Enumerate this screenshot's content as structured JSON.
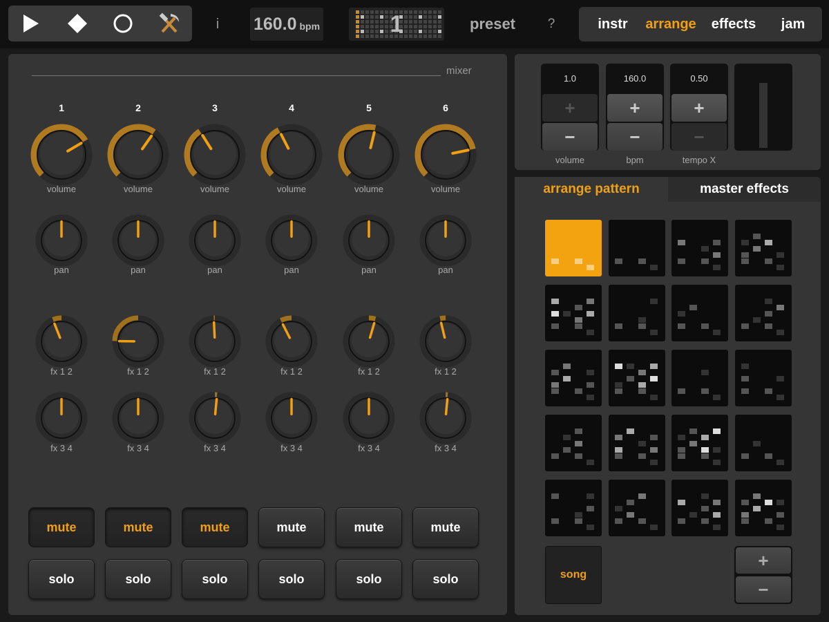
{
  "topbar": {
    "info_label": "i",
    "bpm_value": "160.0",
    "bpm_unit": "bpm",
    "current_pattern": "1",
    "preset_label": "preset",
    "help_label": "?",
    "tabs": [
      {
        "label": "instr",
        "active": false
      },
      {
        "label": "arrange",
        "active": true
      },
      {
        "label": "effects",
        "active": false
      },
      {
        "label": "jam",
        "active": false
      }
    ]
  },
  "mixer": {
    "title": "mixer",
    "knob_labels": {
      "volume": "volume",
      "pan": "pan",
      "fx12": "fx 1 2",
      "fx34": "fx 3 4"
    },
    "channels": [
      {
        "num": "1",
        "volume": 0.72,
        "pan": 0.5,
        "fx12": 0.42,
        "fx34": 0.5,
        "mute_label": "mute",
        "mute_on": true,
        "solo_label": "solo"
      },
      {
        "num": "2",
        "volume": 0.63,
        "pan": 0.5,
        "fx12": 0.17,
        "fx34": 0.5,
        "mute_label": "mute",
        "mute_on": true,
        "solo_label": "solo"
      },
      {
        "num": "3",
        "volume": 0.38,
        "pan": 0.5,
        "fx12": 0.49,
        "fx34": 0.52,
        "mute_label": "mute",
        "mute_on": true,
        "solo_label": "solo"
      },
      {
        "num": "4",
        "volume": 0.4,
        "pan": 0.5,
        "fx12": 0.4,
        "fx34": 0.5,
        "mute_label": "mute",
        "mute_on": false,
        "solo_label": "solo"
      },
      {
        "num": "5",
        "volume": 0.55,
        "pan": 0.5,
        "fx12": 0.56,
        "fx34": 0.5,
        "mute_label": "mute",
        "mute_on": false,
        "solo_label": "solo"
      },
      {
        "num": "6",
        "volume": 0.79,
        "pan": 0.5,
        "fx12": 0.45,
        "fx34": 0.52,
        "mute_label": "mute",
        "mute_on": false,
        "solo_label": "solo"
      }
    ]
  },
  "master": {
    "steppers": [
      {
        "value": "1.0",
        "label": "volume",
        "plus": "+",
        "minus": "−",
        "plus_dim": true,
        "minus_dim": false
      },
      {
        "value": "160.0",
        "label": "bpm",
        "plus": "+",
        "minus": "−",
        "plus_dim": false,
        "minus_dim": false
      },
      {
        "value": "0.50",
        "label": "tempo X",
        "plus": "+",
        "minus": "−",
        "plus_dim": false,
        "minus_dim": true
      }
    ]
  },
  "arrange": {
    "tab_pattern": "arrange pattern",
    "tab_master": "master effects",
    "song_label": "song",
    "add_label": "+",
    "remove_label": "−",
    "selected_pattern": 0,
    "pattern_count": 20
  },
  "colors": {
    "accent": "#f0a010",
    "panel": "#353535",
    "background": "#1a1a1a"
  }
}
